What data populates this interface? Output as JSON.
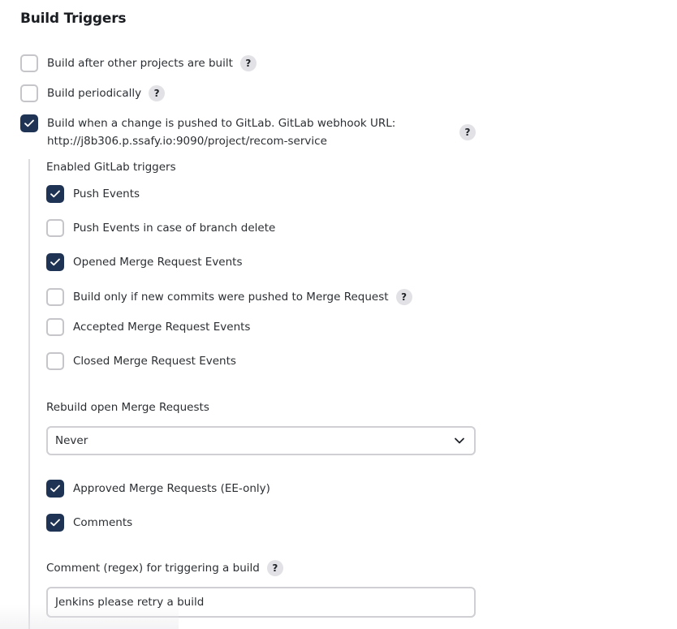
{
  "section_title": "Build Triggers",
  "triggers": {
    "after_other": {
      "label": "Build after other projects are built",
      "checked": false
    },
    "periodically": {
      "label": "Build periodically",
      "checked": false
    },
    "gitlab": {
      "label_line1": "Build when a change is pushed to GitLab. GitLab webhook URL:",
      "label_line2": "http://j8b306.p.ssafy.io:9090/project/recom-service",
      "checked": true
    }
  },
  "gitlab_options": {
    "enabled_label": "Enabled GitLab triggers",
    "push_events": {
      "label": "Push Events",
      "checked": true
    },
    "push_branch_delete": {
      "label": "Push Events in case of branch delete",
      "checked": false
    },
    "opened_mr": {
      "label": "Opened Merge Request Events",
      "checked": true
    },
    "build_only_new_commits": {
      "label": "Build only if new commits were pushed to Merge Request",
      "checked": false
    },
    "accepted_mr": {
      "label": "Accepted Merge Request Events",
      "checked": false
    },
    "closed_mr": {
      "label": "Closed Merge Request Events",
      "checked": false
    },
    "rebuild_label": "Rebuild open Merge Requests",
    "rebuild_value": "Never",
    "approved_mr": {
      "label": "Approved Merge Requests (EE-only)",
      "checked": true
    },
    "comments": {
      "label": "Comments",
      "checked": true
    },
    "comment_regex_label": "Comment (regex) for triggering a build",
    "comment_regex_value": "Jenkins please retry a build"
  },
  "help_glyph": "?",
  "colors": {
    "checked_bg": "#1f3354",
    "border": "#c5c5ca",
    "help_bg": "#e2e2e6"
  },
  "icons": {
    "check": "check-icon",
    "help": "help-icon",
    "dropdown": "chevron-down-icon"
  }
}
